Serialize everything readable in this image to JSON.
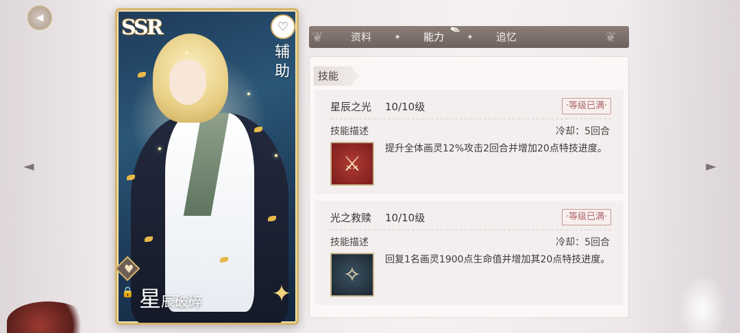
{
  "card": {
    "rarity": "SSR",
    "role": "辅助",
    "name_first": "星",
    "name_rest": "辰破碎"
  },
  "tabs": [
    {
      "label": "资料",
      "active": false
    },
    {
      "label": "能力",
      "active": true
    },
    {
      "label": "追忆",
      "active": false
    }
  ],
  "section_label": "技能",
  "skills": [
    {
      "name": "星辰之光",
      "level": "10/10级",
      "badge": "·等级已满·",
      "desc_label": "技能描述",
      "cooldown": "冷却：5回合",
      "description": "提升全体画灵12%攻击2回合并增加20点特技进度。",
      "icon": "crossed-weapons-icon"
    },
    {
      "name": "光之救赎",
      "level": "10/10级",
      "badge": "·等级已满·",
      "desc_label": "技能描述",
      "cooldown": "冷却：5回合",
      "description": "回复1名画灵1900点生命值并增加其20点特技进度。",
      "icon": "starlight-leaf-icon"
    }
  ],
  "colors": {
    "accent_gold": "#d6b56a",
    "tab_bar": "#7b6f69",
    "max_badge": "#b0666a"
  }
}
